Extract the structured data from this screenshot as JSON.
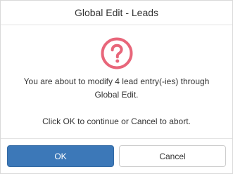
{
  "dialog": {
    "title": "Global Edit - Leads",
    "icon": "question-circle-icon",
    "icon_color": "#e8667a",
    "message_line1": "You are about to modify 4 lead entry(-ies) through Global Edit.",
    "message_line2": "Click OK to continue or Cancel to abort."
  },
  "footer": {
    "ok_label": "OK",
    "cancel_label": "Cancel"
  },
  "colors": {
    "primary": "#3c78b8",
    "icon": "#e8667a"
  }
}
